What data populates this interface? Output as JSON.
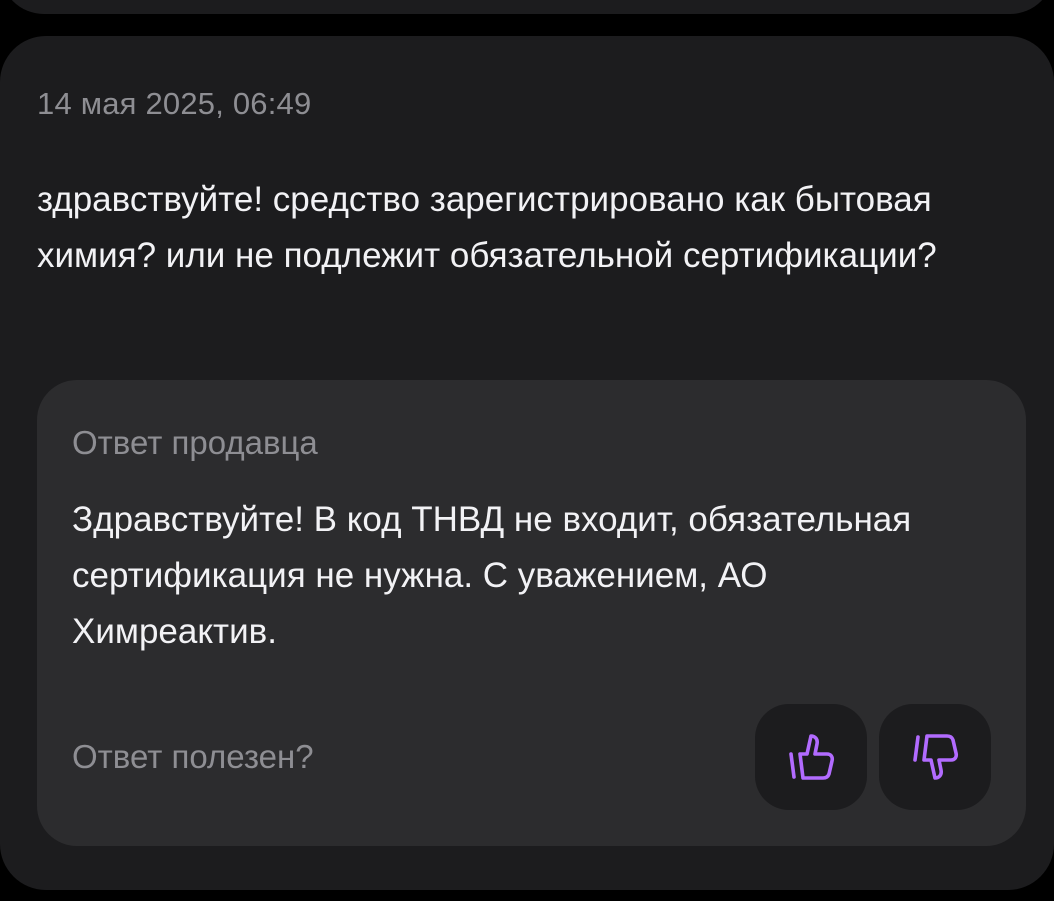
{
  "question": {
    "timestamp": "14 мая 2025, 06:49",
    "text": "здравствуйте! средство зарегистрировано как бытовая химия? или не подлежит обязательной сертификации?"
  },
  "answer": {
    "title": "Ответ продавца",
    "text": "Здравствуйте! В код ТНВД не входит, обязательная сертификация не нужна. С уважением, АО Химреактив."
  },
  "feedback": {
    "label": "Ответ полезен?",
    "like_icon": "thumbs-up-icon",
    "dislike_icon": "thumbs-down-icon"
  },
  "colors": {
    "background": "#000000",
    "card": "#1c1c1e",
    "answer_card": "#2c2c2e",
    "primary_text": "#f2f2f5",
    "secondary_text": "#8e8e93",
    "accent": "#b26bff"
  }
}
